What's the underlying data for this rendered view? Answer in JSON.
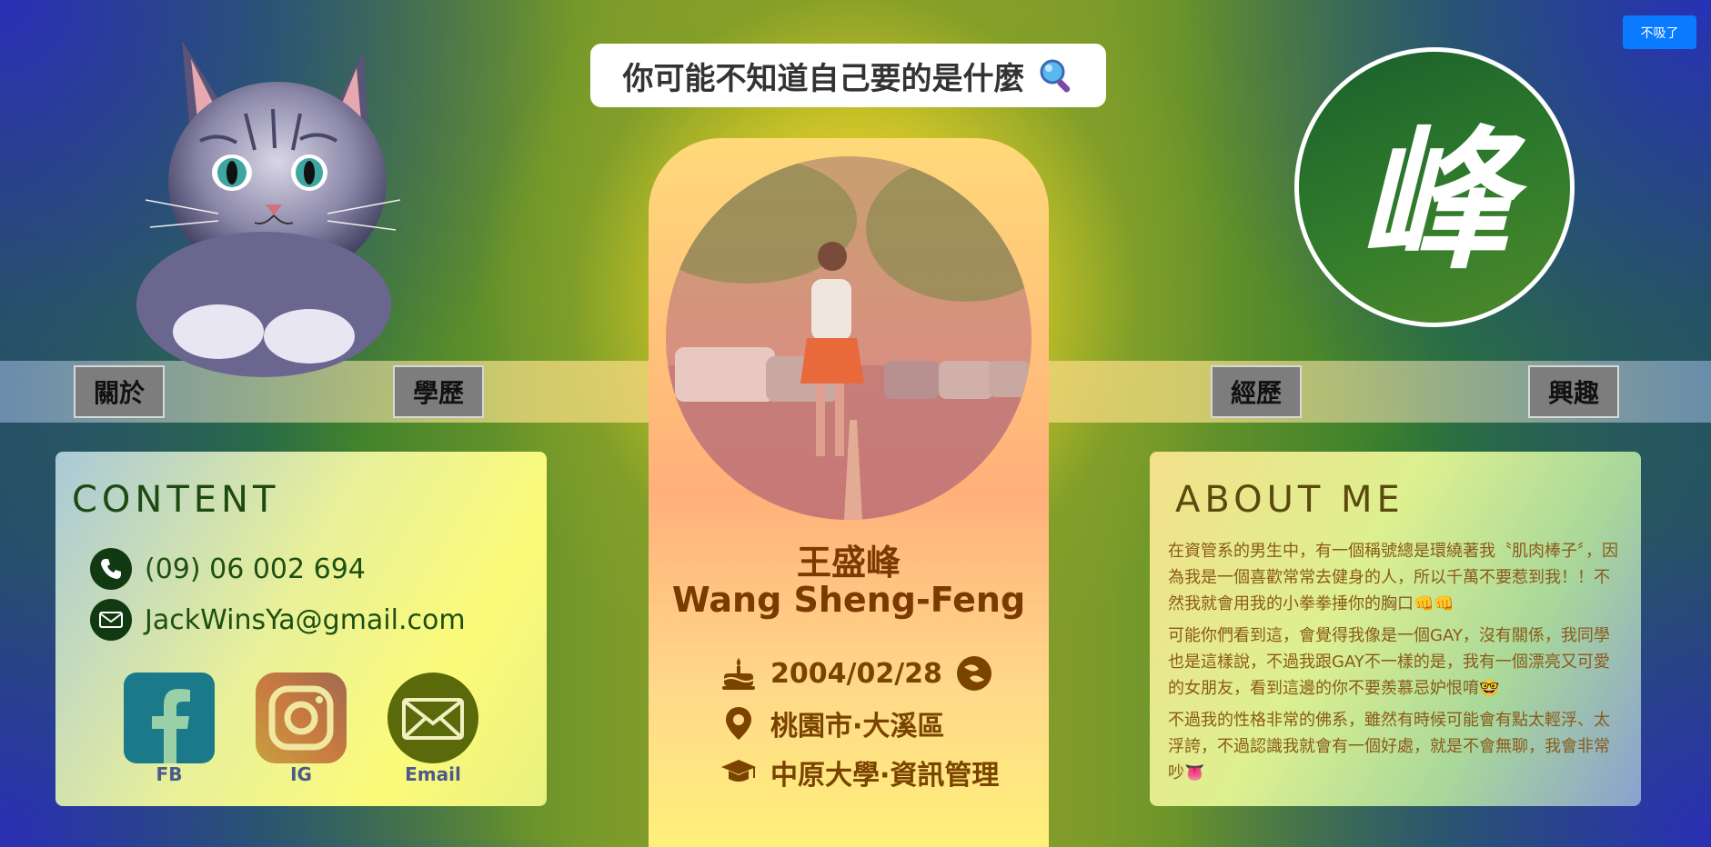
{
  "header": {
    "banner_text": "你可能不知道自己要的是什麼",
    "dismiss_label": "不吸了",
    "logo_char": "峰"
  },
  "nav": {
    "about": "關於",
    "education": "學歷",
    "experience": "經歷",
    "interests": "興趣"
  },
  "profile": {
    "name_cn": "王盛峰",
    "name_en": "Wang Sheng-Feng",
    "birthday": "2004/02/28",
    "location": "桃園市·大溪區",
    "school": "中原大學·資訊管理"
  },
  "contact": {
    "title": "CONTENT",
    "phone": "(09) 06 002 694",
    "email": "JackWinsYa@gmail.com",
    "social": [
      {
        "label": "FB"
      },
      {
        "label": "IG"
      },
      {
        "label": "Email"
      }
    ]
  },
  "about": {
    "title": "ABOUT ME",
    "paragraphs": [
      "在資管系的男生中，有一個稱號總是環繞著我〝肌肉棒子〞，因為我是一個喜歡常常去健身的人，所以千萬不要惹到我！！不然我就會用我的小拳拳捶你的胸口👊👊",
      "可能你們看到這，會覺得我像是一個GAY，沒有關係，我同學也是這樣說，不過我跟GAY不一樣的是，我有一個漂亮又可愛的女朋友，看到這邊的你不要羨慕忌妒恨唷🤓",
      "不過我的性格非常的佛系，雖然有時候可能會有點太輕浮、太浮誇，不過認識我就會有一個好處，就是不會無聊，我會非常吵👅"
    ]
  },
  "colors": {
    "dismiss_button": "#0a7bff",
    "nav_button": "#7d7d7d",
    "logo_green": "#1a5f2c"
  }
}
